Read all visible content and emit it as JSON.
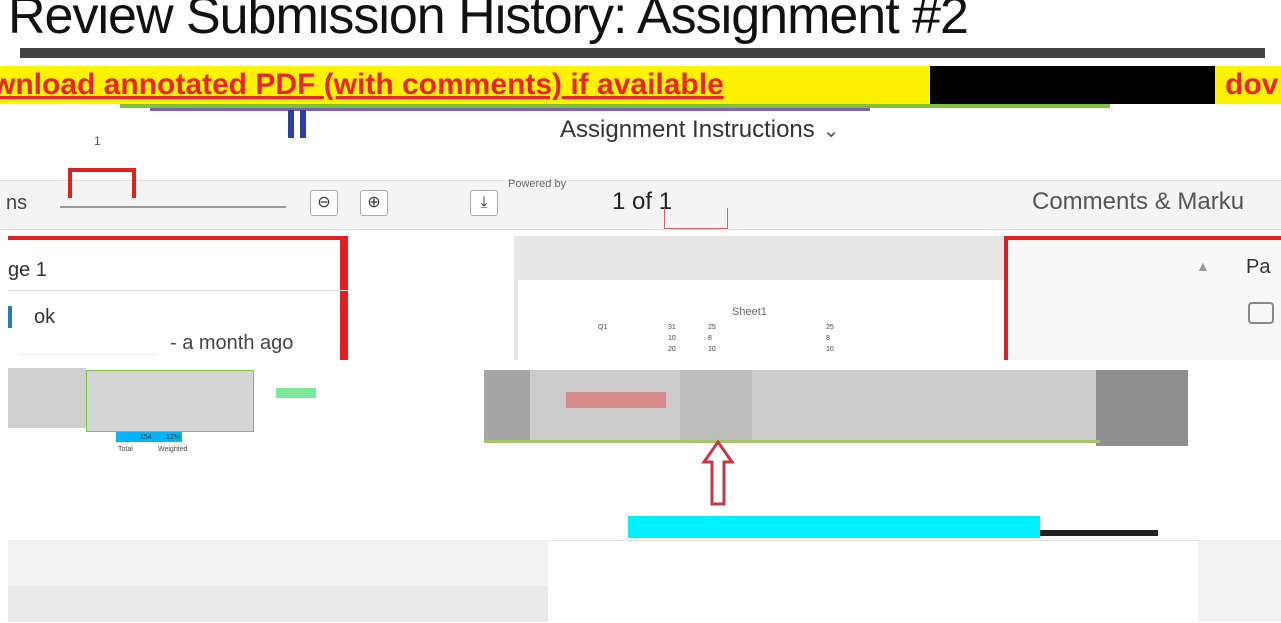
{
  "page": {
    "title": "Review Submission History: Assignment #2",
    "banner_left": "wnload annotated PDF (with comments) if available",
    "banner_right": "dov",
    "instructions_label": "Assignment Instructions",
    "instructions_chevron": "⌄",
    "marker_number": "1"
  },
  "toolbar": {
    "options_label": "ns",
    "zoom_out": "⊖",
    "zoom_in": "⊕",
    "download": "⤓",
    "page_count": "1 of 1",
    "powered_by": "Powered by",
    "comments_tab": "Comments & Marku"
  },
  "left_panel": {
    "page_header": "ge 1",
    "comment_text": "ok",
    "comment_meta": "- a month ago"
  },
  "document": {
    "sheet_title": "Sheet1",
    "rows": [
      [
        "Q1",
        "31",
        "25",
        "25"
      ],
      [
        "",
        "10",
        "8",
        "8"
      ],
      [
        "",
        "20",
        "10",
        "10"
      ]
    ],
    "thumb_labels": [
      "Total",
      "Weighted",
      "154",
      "12%"
    ]
  },
  "right_panel": {
    "page_header": "Pa"
  },
  "colors": {
    "banner_bg": "#fff200",
    "banner_text": "#e8262a",
    "highlight_red": "#e02020",
    "cyan": "#00f0ff",
    "green_line": "#7dc142"
  },
  "icons": {
    "chevron": "chevron-down-icon",
    "comment": "comment-icon",
    "arrow": "up-arrow-icon"
  }
}
